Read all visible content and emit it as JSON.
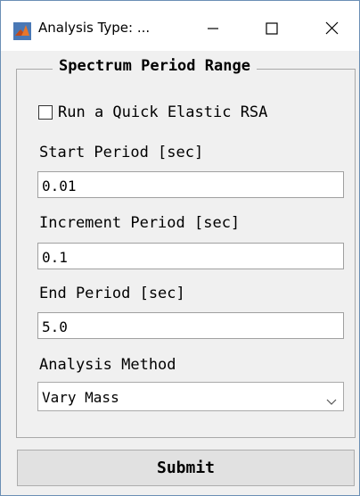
{
  "window": {
    "title": "Analysis Type: ..."
  },
  "panel": {
    "title": "Spectrum Period Range",
    "quick_rsa_label": "Run a Quick Elastic RSA",
    "quick_rsa_checked": false,
    "start_period": {
      "label": "Start Period [sec]",
      "value": "0.01"
    },
    "increment_period": {
      "label": "Increment Period [sec]",
      "value": "0.1"
    },
    "end_period": {
      "label": "End Period [sec]",
      "value": "5.0"
    },
    "analysis_method": {
      "label": "Analysis Method",
      "selected": "Vary Mass"
    }
  },
  "submit_label": "Submit",
  "icons": {
    "app": "matlab-icon",
    "minimize": "minimize-icon",
    "maximize": "maximize-icon",
    "close": "close-icon",
    "dropdown": "chevron-down-icon"
  },
  "colors": {
    "window_bg": "#f0f0f0",
    "titlebar_bg": "#ffffff",
    "window_border": "#6b8fb5"
  }
}
